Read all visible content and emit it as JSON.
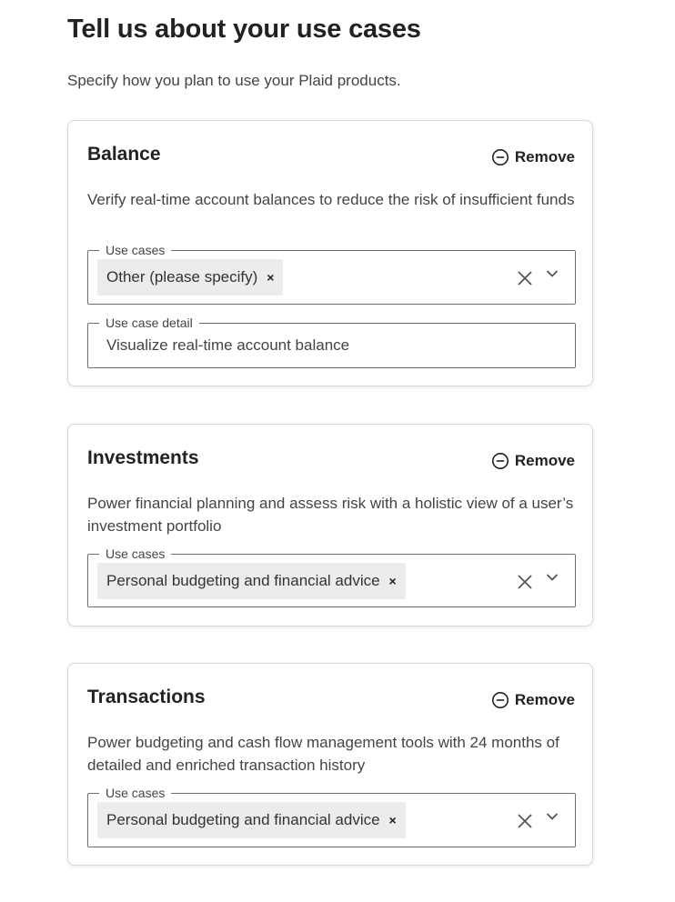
{
  "header": {
    "title": "Tell us about your use cases",
    "subtitle": "Specify how you plan to use your Plaid products."
  },
  "cards": [
    {
      "title": "Balance",
      "remove_label": "Remove",
      "description": "Verify real-time account balances to reduce the risk of insufficient funds",
      "use_cases_label": "Use cases",
      "selected_use_case": "Other (please specify)",
      "chip_remove_glyph": "×",
      "detail_label": "Use case detail",
      "detail_value": "Visualize real-time account balance"
    },
    {
      "title": "Investments",
      "remove_label": "Remove",
      "description": "Power financial planning and assess risk with a holistic view of a user’s investment portfolio",
      "use_cases_label": "Use cases",
      "selected_use_case": "Personal budgeting and financial advice",
      "chip_remove_glyph": "×"
    },
    {
      "title": "Transactions",
      "remove_label": "Remove",
      "description": "Power budgeting and cash flow management tools with 24 months of detailed and enriched transaction history",
      "use_cases_label": "Use cases",
      "selected_use_case": "Personal budgeting and financial advice",
      "chip_remove_glyph": "×"
    }
  ]
}
